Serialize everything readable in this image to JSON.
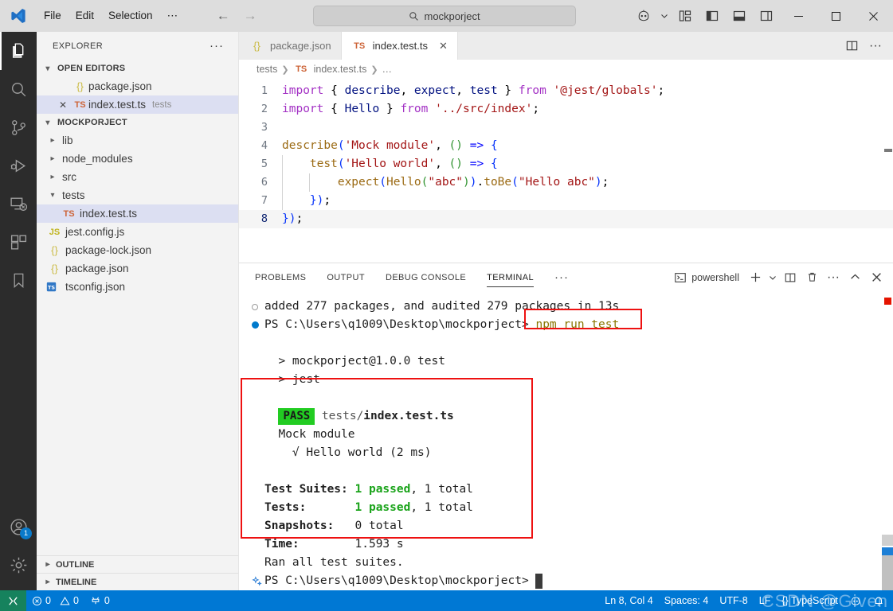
{
  "titlebar": {
    "menus": [
      "File",
      "Edit",
      "Selection",
      "⋯"
    ],
    "nav_back": "←",
    "nav_forward": "→",
    "search_value": "mockporject",
    "search_icon": "search-icon",
    "icons": [
      "remote-copilot-icon",
      "chevron-down-icon",
      "customize-layout-icon",
      "toggle-primary-sidebar-icon",
      "toggle-panel-icon",
      "toggle-secondary-sidebar-icon"
    ],
    "window_minimize": "─",
    "window_maximize": "☐",
    "window_close": "✕"
  },
  "activitybar": {
    "items": [
      {
        "name": "explorer",
        "icon": "files-icon",
        "active": true
      },
      {
        "name": "search",
        "icon": "search-icon",
        "active": false
      },
      {
        "name": "source-control",
        "icon": "source-control-icon",
        "active": false
      },
      {
        "name": "run-and-debug",
        "icon": "run-debug-icon",
        "active": false
      },
      {
        "name": "remote-explorer",
        "icon": "remote-explorer-icon",
        "active": false
      },
      {
        "name": "extensions",
        "icon": "extensions-icon",
        "active": false
      },
      {
        "name": "bookmarks",
        "icon": "bookmark-icon",
        "active": false
      }
    ],
    "accounts": {
      "icon": "account-icon",
      "badge": "1"
    },
    "settings": {
      "icon": "gear-icon"
    }
  },
  "sidebar": {
    "title": "EXPLORER",
    "more_actions": "···",
    "open_editors": {
      "label": "OPEN EDITORS",
      "expanded": true,
      "items": [
        {
          "name": "package.json",
          "icon": "json-file-icon",
          "tag": "",
          "selected": false,
          "dirty_close": false
        },
        {
          "name": "index.test.ts",
          "icon": "typescript-file-icon",
          "tag": "tests",
          "selected": true,
          "dirty_close": true
        }
      ]
    },
    "project": {
      "label": "MOCKPORJECT",
      "expanded": true,
      "items": [
        {
          "name": "lib",
          "type": "folder",
          "expanded": false,
          "depth": 1
        },
        {
          "name": "node_modules",
          "type": "folder",
          "expanded": false,
          "depth": 1
        },
        {
          "name": "src",
          "type": "folder",
          "expanded": false,
          "depth": 1
        },
        {
          "name": "tests",
          "type": "folder",
          "expanded": true,
          "depth": 1
        },
        {
          "name": "index.test.ts",
          "type": "ts",
          "depth": 2,
          "selected": true
        },
        {
          "name": "jest.config.js",
          "type": "js",
          "depth": 1
        },
        {
          "name": "package-lock.json",
          "type": "json",
          "depth": 1
        },
        {
          "name": "package.json",
          "type": "json",
          "depth": 1
        },
        {
          "name": "tsconfig.json",
          "type": "tsconfig",
          "depth": 1
        }
      ]
    },
    "outline": "OUTLINE",
    "timeline": "TIMELINE"
  },
  "editor": {
    "tabs": [
      {
        "label": "package.json",
        "icon": "json-file-icon",
        "active": false,
        "closable": false
      },
      {
        "label": "index.test.ts",
        "icon": "typescript-file-icon",
        "active": true,
        "closable": true
      }
    ],
    "tab_actions": [
      "split-editor-icon",
      "more-actions-icon"
    ],
    "breadcrumb": [
      "tests",
      "index.test.ts",
      "…"
    ],
    "lines": [
      {
        "n": "1",
        "tokens": [
          {
            "t": "import",
            "c": "kw"
          },
          {
            "t": " { ",
            "c": "plain"
          },
          {
            "t": "describe",
            "c": "var"
          },
          {
            "t": ", ",
            "c": "plain"
          },
          {
            "t": "expect",
            "c": "var"
          },
          {
            "t": ", ",
            "c": "plain"
          },
          {
            "t": "test",
            "c": "var"
          },
          {
            "t": " } ",
            "c": "plain"
          },
          {
            "t": "from",
            "c": "kw"
          },
          {
            "t": " ",
            "c": "plain"
          },
          {
            "t": "'@jest/globals'",
            "c": "str"
          },
          {
            "t": ";",
            "c": "plain"
          }
        ]
      },
      {
        "n": "2",
        "tokens": [
          {
            "t": "import",
            "c": "kw"
          },
          {
            "t": " { ",
            "c": "plain"
          },
          {
            "t": "Hello",
            "c": "var"
          },
          {
            "t": " } ",
            "c": "plain"
          },
          {
            "t": "from",
            "c": "kw"
          },
          {
            "t": " ",
            "c": "plain"
          },
          {
            "t": "'../src/index'",
            "c": "str"
          },
          {
            "t": ";",
            "c": "plain"
          }
        ]
      },
      {
        "n": "3",
        "tokens": []
      },
      {
        "n": "4",
        "tokens": [
          {
            "t": "describe",
            "c": "fn"
          },
          {
            "t": "(",
            "c": "pl"
          },
          {
            "t": "'Mock module'",
            "c": "str"
          },
          {
            "t": ", ",
            "c": "plain"
          },
          {
            "t": "()",
            "c": "pl2"
          },
          {
            "t": " ",
            "c": "plain"
          },
          {
            "t": "=>",
            "c": "kw2"
          },
          {
            "t": " ",
            "c": "plain"
          },
          {
            "t": "{",
            "c": "pl"
          }
        ]
      },
      {
        "n": "5",
        "tokens": [
          {
            "t": "    ",
            "c": "plain"
          },
          {
            "t": "test",
            "c": "fn"
          },
          {
            "t": "(",
            "c": "pl"
          },
          {
            "t": "'Hello world'",
            "c": "str"
          },
          {
            "t": ", ",
            "c": "plain"
          },
          {
            "t": "()",
            "c": "pl2"
          },
          {
            "t": " ",
            "c": "plain"
          },
          {
            "t": "=>",
            "c": "kw2"
          },
          {
            "t": " ",
            "c": "plain"
          },
          {
            "t": "{",
            "c": "pl"
          }
        ]
      },
      {
        "n": "6",
        "tokens": [
          {
            "t": "        ",
            "c": "plain"
          },
          {
            "t": "expect",
            "c": "fn"
          },
          {
            "t": "(",
            "c": "pl"
          },
          {
            "t": "Hello",
            "c": "fn"
          },
          {
            "t": "(",
            "c": "pl2"
          },
          {
            "t": "\"abc\"",
            "c": "str"
          },
          {
            "t": ")",
            "c": "pl2"
          },
          {
            "t": ")",
            "c": "pl"
          },
          {
            "t": ".",
            "c": "plain"
          },
          {
            "t": "toBe",
            "c": "fn"
          },
          {
            "t": "(",
            "c": "pl"
          },
          {
            "t": "\"Hello abc\"",
            "c": "str"
          },
          {
            "t": ")",
            "c": "pl"
          },
          {
            "t": ";",
            "c": "plain"
          }
        ]
      },
      {
        "n": "7",
        "tokens": [
          {
            "t": "    ",
            "c": "plain"
          },
          {
            "t": "}",
            "c": "pl"
          },
          {
            "t": ")",
            "c": "pl"
          },
          {
            "t": ";",
            "c": "plain"
          }
        ]
      },
      {
        "n": "8",
        "tokens": [
          {
            "t": "}",
            "c": "pl"
          },
          {
            "t": ")",
            "c": "pl"
          },
          {
            "t": ";",
            "c": "plain"
          }
        ]
      }
    ]
  },
  "panel": {
    "tabs": [
      {
        "label": "PROBLEMS",
        "active": false
      },
      {
        "label": "OUTPUT",
        "active": false
      },
      {
        "label": "DEBUG CONSOLE",
        "active": false
      },
      {
        "label": "TERMINAL",
        "active": true
      }
    ],
    "tabs_more": "···",
    "shell": "powershell",
    "shell_icon": "terminal-icon",
    "actions": [
      "new-terminal-icon",
      "chevron-down-icon",
      "split-terminal-icon",
      "kill-terminal-icon",
      "more-actions-icon",
      "maximize-panel-icon",
      "close-panel-icon"
    ]
  },
  "terminal": {
    "lines": [
      {
        "gutter": "hollow",
        "segments": [
          {
            "t": "added 277 packages, and audited 279 packages in 13s",
            "c": "plain"
          }
        ]
      },
      {
        "gutter": "blue",
        "segments": [
          {
            "t": "PS C:\\Users\\q1009\\Desktop\\mockporject> ",
            "c": "plain"
          },
          {
            "t": "npm run test",
            "c": "cmd"
          }
        ]
      },
      {
        "gutter": "",
        "segments": []
      },
      {
        "gutter": "",
        "segments": [
          {
            "t": "  > mockporject@1.0.0 test",
            "c": "plain"
          }
        ]
      },
      {
        "gutter": "",
        "segments": [
          {
            "t": "  > jest",
            "c": "plain"
          }
        ]
      },
      {
        "gutter": "",
        "segments": []
      },
      {
        "gutter": "",
        "segments": [
          {
            "t": "PASS",
            "c": "pass"
          },
          {
            "t": " tests/",
            "c": "gray"
          },
          {
            "t": "index.test.ts",
            "c": "bold"
          }
        ]
      },
      {
        "gutter": "",
        "segments": [
          {
            "t": "  Mock module",
            "c": "plain"
          }
        ]
      },
      {
        "gutter": "",
        "segments": [
          {
            "t": "    √ Hello world (2 ms)",
            "c": "check"
          }
        ]
      },
      {
        "gutter": "",
        "segments": []
      },
      {
        "gutter": "",
        "segments": [
          {
            "t": "Test Suites: ",
            "c": "bold"
          },
          {
            "t": "1 passed",
            "c": "green"
          },
          {
            "t": ", 1 total",
            "c": "plain"
          }
        ]
      },
      {
        "gutter": "",
        "segments": [
          {
            "t": "Tests:       ",
            "c": "bold"
          },
          {
            "t": "1 passed",
            "c": "green"
          },
          {
            "t": ", 1 total",
            "c": "plain"
          }
        ]
      },
      {
        "gutter": "",
        "segments": [
          {
            "t": "Snapshots:   ",
            "c": "bold"
          },
          {
            "t": "0 total",
            "c": "plain"
          }
        ]
      },
      {
        "gutter": "",
        "segments": [
          {
            "t": "Time:        ",
            "c": "bold"
          },
          {
            "t": "1.593 s",
            "c": "plain"
          }
        ]
      },
      {
        "gutter": "",
        "segments": [
          {
            "t": "Ran all test suites.",
            "c": "plain"
          }
        ]
      },
      {
        "gutter": "sparkle",
        "segments": [
          {
            "t": "PS C:\\Users\\q1009\\Desktop\\mockporject> ",
            "c": "plain"
          },
          {
            "t": "",
            "c": "cursor"
          }
        ]
      }
    ]
  },
  "statusbar": {
    "remote_icon": "remote-window-icon",
    "errors": {
      "icon": "error-icon",
      "count": "0"
    },
    "warnings": {
      "icon": "warning-icon",
      "count": "0"
    },
    "ports": {
      "icon": "ports-icon",
      "count": "0"
    },
    "right": [
      {
        "name": "cursor-position",
        "label": "Ln 8, Col 4"
      },
      {
        "name": "indentation",
        "label": "Spaces: 4"
      },
      {
        "name": "encoding",
        "label": "UTF-8"
      },
      {
        "name": "eol",
        "label": "LF"
      },
      {
        "name": "language-mode",
        "label": "{} TypeScript"
      }
    ],
    "watermark": "CSDN @Given"
  },
  "colors": {
    "accent": "#0078d4",
    "remote_green": "#16825d",
    "pass_green": "#22cc22",
    "highlight_red": "#ee1111",
    "command_olive": "#8a7600"
  }
}
